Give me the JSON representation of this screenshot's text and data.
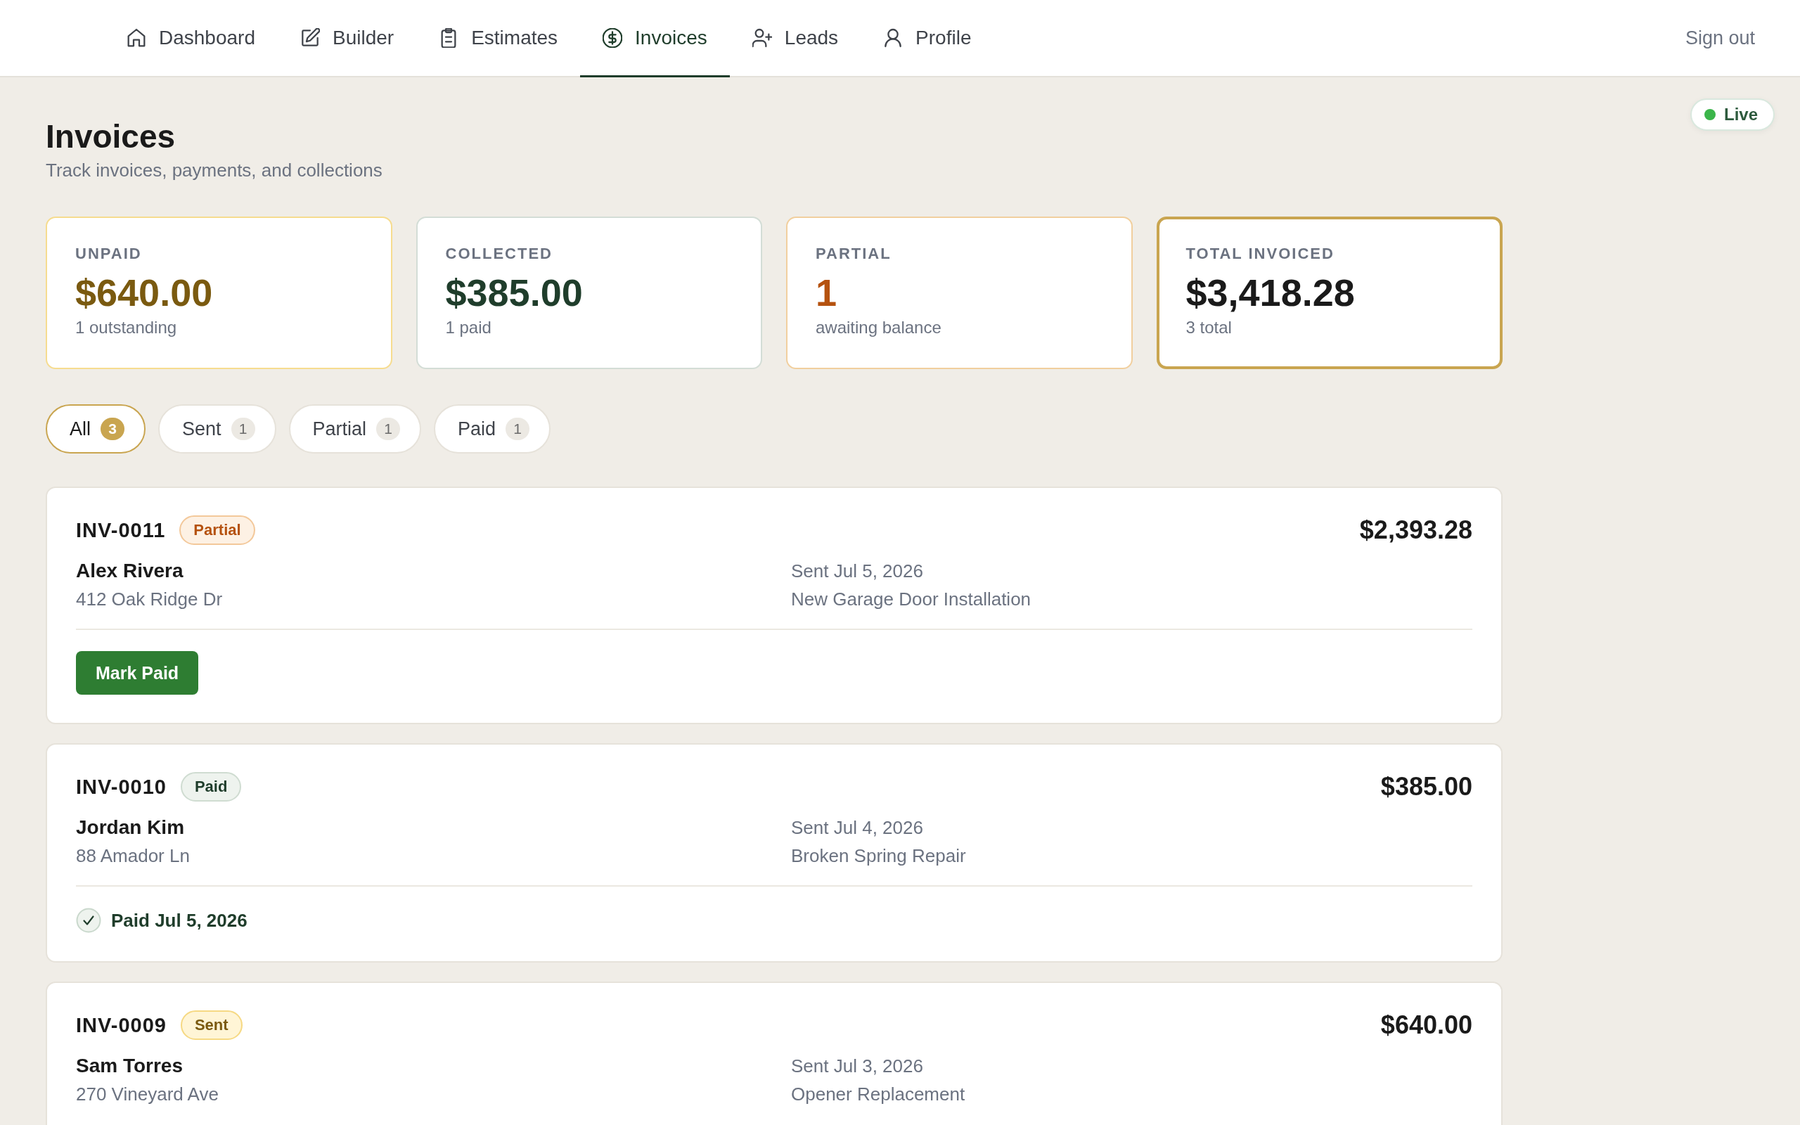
{
  "nav": {
    "items": [
      {
        "label": "Dashboard",
        "selected": false
      },
      {
        "label": "Builder",
        "selected": false
      },
      {
        "label": "Estimates",
        "selected": false
      },
      {
        "label": "Invoices",
        "selected": true
      },
      {
        "label": "Leads",
        "selected": false
      },
      {
        "label": "Profile",
        "selected": false
      }
    ],
    "sign_out": "Sign out"
  },
  "live_status": {
    "label": "Live"
  },
  "header": {
    "title": "Invoices",
    "subtitle": "Track invoices, payments, and collections"
  },
  "stats": [
    {
      "kind": "unpaid",
      "label": "UNPAID",
      "value": "$640.00",
      "note": "1 outstanding"
    },
    {
      "kind": "collected",
      "label": "COLLECTED",
      "value": "$385.00",
      "note": "1 paid"
    },
    {
      "kind": "partial",
      "label": "PARTIAL",
      "value": "1",
      "note": "awaiting balance"
    },
    {
      "kind": "total",
      "label": "TOTAL INVOICED",
      "value": "$3,418.28",
      "note": "3 total"
    }
  ],
  "filters": [
    {
      "label": "All",
      "count": "3",
      "selected": true
    },
    {
      "label": "Sent",
      "count": "1",
      "selected": false
    },
    {
      "label": "Partial",
      "count": "1",
      "selected": false
    },
    {
      "label": "Paid",
      "count": "1",
      "selected": false
    }
  ],
  "invoices": [
    {
      "number": "INV-0011",
      "status": {
        "kind": "partial",
        "label": "Partial"
      },
      "amount": "$2,393.28",
      "customer": "Alex Rivera",
      "address": "412 Oak Ridge Dr",
      "sent": "Sent Jul 5, 2026",
      "job": "New Garage Door Installation",
      "footer": {
        "kind": "button",
        "label": "Mark Paid"
      }
    },
    {
      "number": "INV-0010",
      "status": {
        "kind": "paid",
        "label": "Paid"
      },
      "amount": "$385.00",
      "customer": "Jordan Kim",
      "address": "88 Amador Ln",
      "sent": "Sent Jul 4, 2026",
      "job": "Broken Spring Repair",
      "footer": {
        "kind": "paid_note",
        "label": "Paid Jul 5, 2026"
      }
    },
    {
      "number": "INV-0009",
      "status": {
        "kind": "sent",
        "label": "Sent"
      },
      "amount": "$640.00",
      "customer": "Sam Torres",
      "address": "270 Vineyard Ave",
      "sent": "Sent Jul 3, 2026",
      "job": "Opener Replacement"
    }
  ]
}
